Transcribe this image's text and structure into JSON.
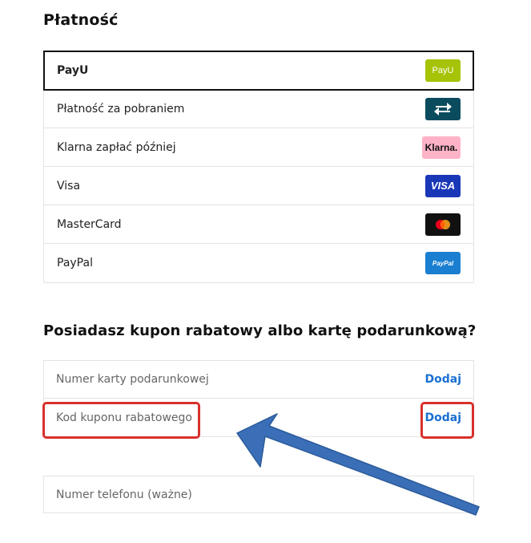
{
  "payment": {
    "title": "Płatność",
    "methods": [
      {
        "label": "PayU",
        "logo_text": "PayU",
        "icon": "payu-logo",
        "selected": true
      },
      {
        "label": "Płatność za pobraniem",
        "logo_text": "",
        "icon": "swap-arrows-icon",
        "selected": false
      },
      {
        "label": "Klarna zapłać później",
        "logo_text": "Klarna.",
        "icon": "klarna-logo",
        "selected": false
      },
      {
        "label": "Visa",
        "logo_text": "VISA",
        "icon": "visa-logo",
        "selected": false
      },
      {
        "label": "MasterCard",
        "logo_text": "",
        "icon": "mastercard-logo",
        "selected": false
      },
      {
        "label": "PayPal",
        "logo_text": "PayPal",
        "icon": "paypal-logo",
        "selected": false
      }
    ]
  },
  "coupon": {
    "title": "Posiadasz kupon rabatowy albo kartę podarunkową?",
    "gift_card_placeholder": "Numer karty podarunkowej",
    "gift_card_add": "Dodaj",
    "coupon_placeholder": "Kod kuponu rabatowego",
    "coupon_add": "Dodaj"
  },
  "phone": {
    "placeholder": "Numer telefonu (ważne)"
  },
  "colors": {
    "link": "#1a6fd1",
    "highlight": "#d9302c",
    "arrow": "#3a6fb8",
    "payu": "#a6c307",
    "cod": "#0b4b5e",
    "klarna": "#ffb3c7",
    "visa": "#1a37b8",
    "paypal": "#1a7fd0"
  }
}
